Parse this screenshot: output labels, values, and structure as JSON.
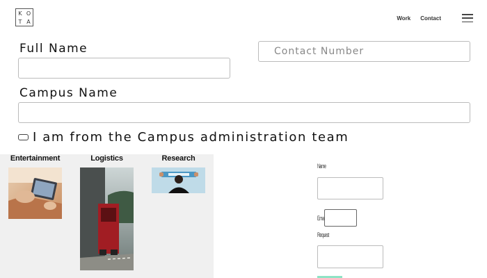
{
  "header": {
    "logo_letters": [
      "K",
      "O",
      "T",
      "A"
    ],
    "nav": [
      {
        "label": "Work"
      },
      {
        "label": "Contact"
      }
    ],
    "menu_icon": "hamburger-menu-icon"
  },
  "form": {
    "full_name": {
      "label": "Full Name",
      "value": ""
    },
    "contact_number": {
      "placeholder": "Contact Number",
      "value": ""
    },
    "campus_name": {
      "label": "Campus Name",
      "value": ""
    },
    "admin_checkbox": {
      "label": "I am from the Campus administration team",
      "checked": false
    }
  },
  "categories": [
    {
      "title": "Entertainment",
      "image": "tablet-user-photo"
    },
    {
      "title": "Logistics",
      "image": "red-truck-photo"
    },
    {
      "title": "Research",
      "image": "person-with-blue-card-photo"
    }
  ],
  "mini_form": {
    "labels": [
      "Name",
      "Email",
      "Request"
    ]
  }
}
